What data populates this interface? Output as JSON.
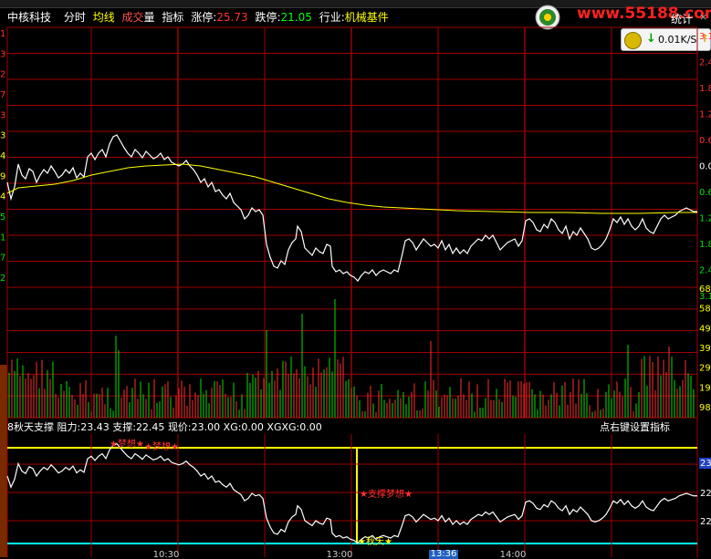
{
  "stock": {
    "name": "中核科技",
    "tabs": [
      "分时",
      "均线",
      "成交",
      "量",
      "指标"
    ],
    "limit_up_label": "涨停:",
    "limit_up": "25.73",
    "limit_down_label": "跌停:",
    "limit_down": "21.05",
    "industry_label": "行业:",
    "industry": "机械基件"
  },
  "site": {
    "text": "www.55188.com"
  },
  "window": {
    "stat_label": "统计",
    "close": "×"
  },
  "speed": {
    "value": "0.01K/S"
  },
  "indicator": {
    "name": "8秋天支撑",
    "resistance_label": "阻力:",
    "resistance": "23.43",
    "support_label": "支撑:",
    "support": "22.45",
    "price_label": "现价:",
    "price": "23.00",
    "xg": "XG:0.00",
    "xgxg": "XGXG:0.00",
    "right_hint": "点右键设置指标",
    "marker_top": "★梦想★",
    "marker_top2": "★梦想★",
    "marker_mid": "★支撑梦想★",
    "marker_bot": "★秋天★"
  },
  "left_axis": [
    "1",
    "3",
    "2",
    "7",
    "3",
    "3",
    "4",
    "9",
    "4",
    "5",
    "1",
    "7",
    "2"
  ],
  "right_axis": [
    "3.1",
    "2.4",
    "1.8",
    "1.2",
    "0.6",
    "0.0",
    "0.6",
    "1.2",
    "1.8",
    "2.4",
    "3.1",
    "68",
    "58",
    "49",
    "39",
    "29",
    "19",
    "98"
  ],
  "sub_right_axis": [
    "23",
    "22",
    "22"
  ],
  "time_axis": [
    "10:30",
    "13:00",
    "14:00"
  ],
  "time_current": "13:36",
  "colors": {
    "grid": "#a00000",
    "price": "#ffffff",
    "avg": "#ffff00",
    "vol_up": "#ff3030",
    "vol_down": "#00e000",
    "resist": "#ffff00",
    "support": "#00ffff"
  }
}
